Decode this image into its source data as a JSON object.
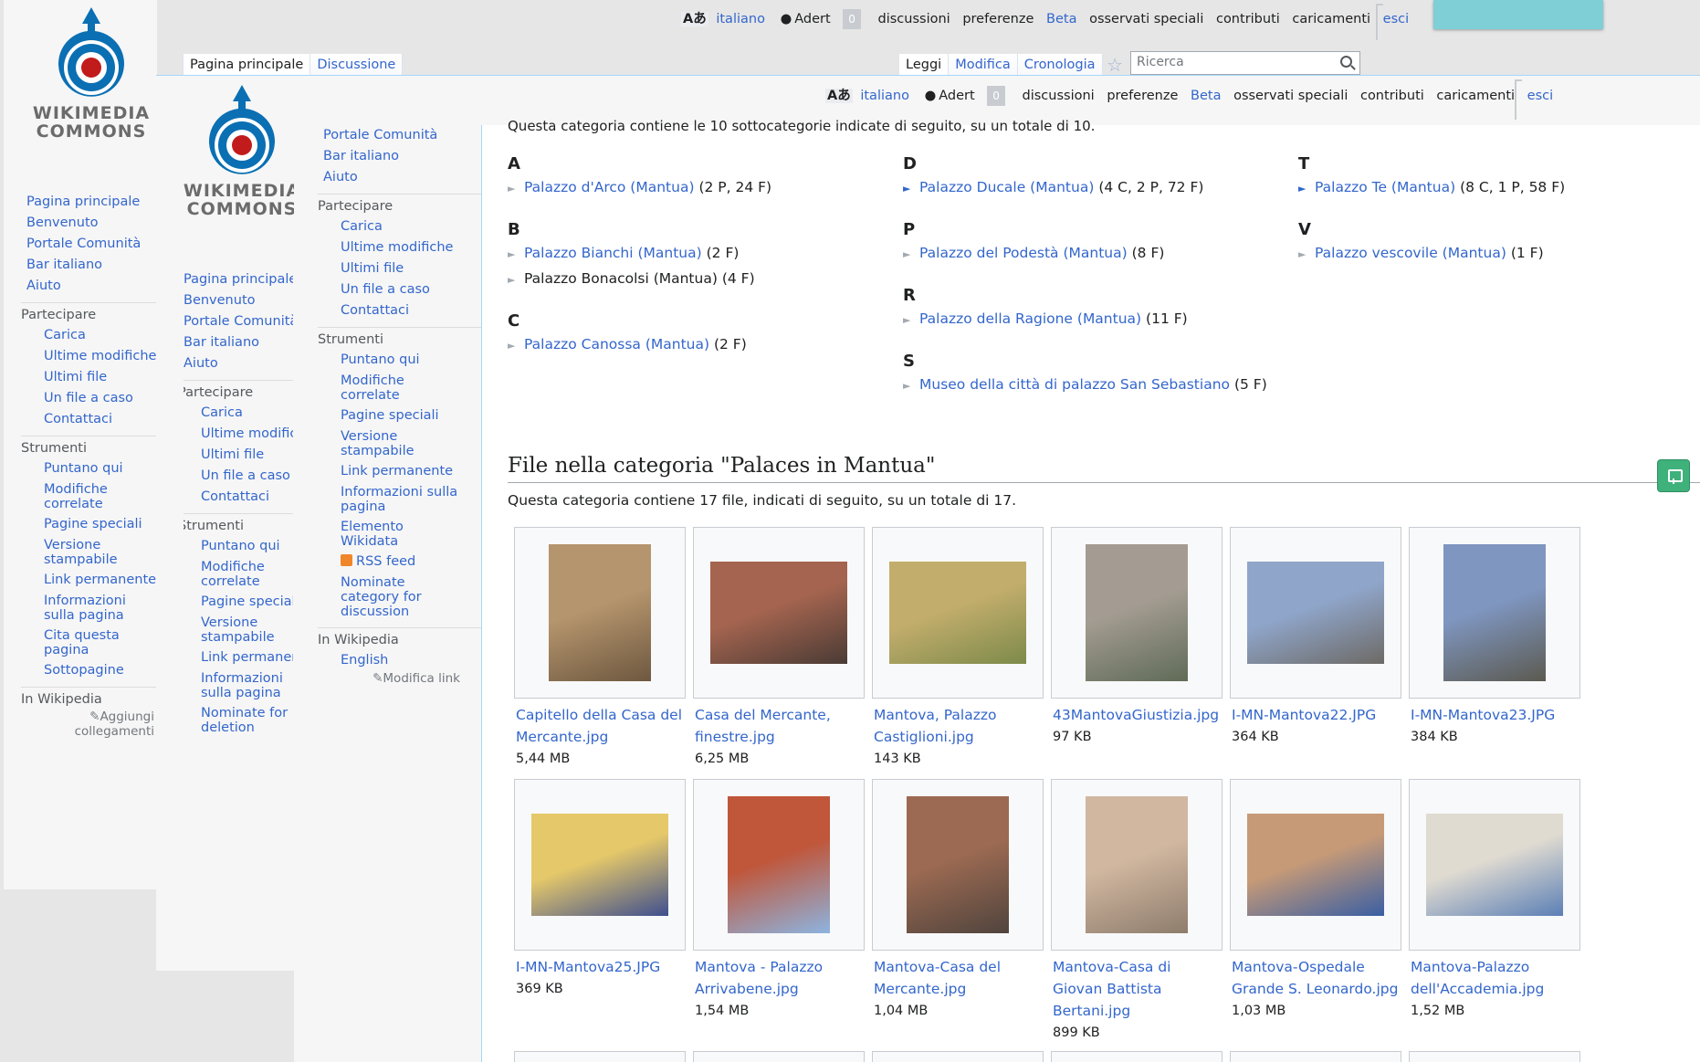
{
  "colors": {
    "link": "#3366cc",
    "badge": "#c8ccd1",
    "green_button": "#3fb17b",
    "teal_panel": "#7fcfd6"
  },
  "logo": {
    "line1": "WIKIMEDIA",
    "line2": "COMMONS"
  },
  "personal": {
    "lang_icon": "translate-icon",
    "language": "italiano",
    "user_icon": "user-icon",
    "user": "Adert",
    "notifications": "0",
    "talk": "discussioni",
    "preferences": "preferenze",
    "beta": "Beta",
    "watchlist": "osservati speciali",
    "contributions": "contributi",
    "uploads": "caricamenti",
    "logout": "esci"
  },
  "tabs": {
    "main_page": "Pagina principale",
    "discussion": "Discussione",
    "read": "Leggi",
    "edit": "Modifica",
    "history": "Cronologia"
  },
  "search": {
    "placeholder": "Ricerca"
  },
  "sidebar1": {
    "nav": [
      "Pagina principale",
      "Benvenuto",
      "Portale Comunità",
      "Bar italiano",
      "Aiuto"
    ],
    "participate_heading": "Partecipare",
    "participate": [
      "Carica",
      "Ultime modifiche",
      "Ultimi file",
      "Un file a caso",
      "Contattaci"
    ],
    "tools_heading": "Strumenti",
    "tools": [
      "Puntano qui",
      "Modifiche correlate",
      "Pagine speciali",
      "Versione stampabile",
      "Link permanente",
      "Informazioni sulla pagina",
      "Cita questa pagina",
      "Sottopagine"
    ],
    "wikipedia_heading": "In Wikipedia",
    "add_links": "Aggiungi collegamenti"
  },
  "sidebar2": {
    "nav": [
      "Pagina principale",
      "Benvenuto",
      "Portale Comunità",
      "Bar italiano",
      "Aiuto"
    ],
    "participate_heading": "Partecipare",
    "participate": [
      "Carica",
      "Ultime modifiche",
      "Ultimi file",
      "Un file a caso",
      "Contattaci"
    ],
    "tools_heading": "Strumenti",
    "tools": [
      "Puntano qui",
      "Modifiche correlate",
      "Pagine speciali",
      "Versione stampabile",
      "Link permanente",
      "Informazioni sulla pagina",
      "Nominate for deletion"
    ]
  },
  "sidebar3": {
    "nav": [
      "Portale Comunità",
      "Bar italiano",
      "Aiuto"
    ],
    "participate_heading": "Partecipare",
    "participate": [
      "Carica",
      "Ultime modifiche",
      "Ultimi file",
      "Un file a caso",
      "Contattaci"
    ],
    "tools_heading": "Strumenti",
    "tools": [
      "Puntano qui",
      "Modifiche correlate",
      "Pagine speciali",
      "Versione stampabile",
      "Link permanente",
      "Informazioni sulla pagina",
      "Elemento Wikidata"
    ],
    "rss": "RSS feed",
    "nominate": "Nominate category for discussion",
    "wikipedia_heading": "In Wikipedia",
    "english": "English",
    "edit_links": "Modifica link"
  },
  "content": {
    "intro": "Questa categoria contiene le 10 sottocategorie indicate di seguito, su un totale di 10.",
    "subcats": [
      {
        "letter": "A",
        "items": [
          {
            "name": "Palazzo d'Arco (Mantua)",
            "count": "(2 P, 24 F)",
            "expand": false
          }
        ]
      },
      {
        "letter": "B",
        "items": [
          {
            "name": "Palazzo Bianchi (Mantua)",
            "count": "(2 F)",
            "expand": false
          },
          {
            "name": "Palazzo Bonacolsi (Mantua)",
            "count": "(4 F)",
            "expand": false
          }
        ]
      },
      {
        "letter": "C",
        "items": [
          {
            "name": "Palazzo Canossa (Mantua)",
            "count": "(2 F)",
            "expand": false
          }
        ]
      },
      {
        "letter": "D",
        "items": [
          {
            "name": "Palazzo Ducale (Mantua)",
            "count": "(4 C, 2 P, 72 F)",
            "expand": true
          }
        ]
      },
      {
        "letter": "P",
        "items": [
          {
            "name": "Palazzo del Podestà (Mantua)",
            "count": "(8 F)",
            "expand": false
          }
        ]
      },
      {
        "letter": "R",
        "items": [
          {
            "name": "Palazzo della Ragione (Mantua)",
            "count": "(11 F)",
            "expand": false
          }
        ]
      },
      {
        "letter": "S",
        "items": [
          {
            "name": "Museo della città di palazzo San Sebastiano",
            "count": "(5 F)",
            "expand": false
          }
        ]
      },
      {
        "letter": "T",
        "items": [
          {
            "name": "Palazzo Te (Mantua)",
            "count": "(8 C, 1 P, 58 F)",
            "expand": true
          }
        ]
      },
      {
        "letter": "V",
        "items": [
          {
            "name": "Palazzo vescovile (Mantua)",
            "count": "(1 F)",
            "expand": false
          }
        ]
      }
    ],
    "files_title": "File nella categoria \"Palaces in Mantua\"",
    "files_intro": "Questa categoria contiene 17 file, indicati di seguito, su un totale di 17.",
    "files": [
      {
        "name": "Capitello della Casa del Mercante.jpg",
        "size": "5,44 MB",
        "colors": [
          "#b5956d",
          "#6e5840"
        ],
        "shape": "portrait"
      },
      {
        "name": "Casa del Mercante, finestre.jpg",
        "size": "6,25 MB",
        "colors": [
          "#a4644f",
          "#4a3b35"
        ],
        "shape": "landscape"
      },
      {
        "name": "Mantova, Palazzo Castiglioni.jpg",
        "size": "143 KB",
        "colors": [
          "#c2ad6c",
          "#7d8a4a"
        ],
        "shape": "landscape"
      },
      {
        "name": "43MantovaGiustizia.jpg",
        "size": "97 KB",
        "colors": [
          "#a49c92",
          "#5f6b57"
        ],
        "shape": "portrait"
      },
      {
        "name": "I-MN-Mantova22.JPG",
        "size": "364 KB",
        "colors": [
          "#8fa5c9",
          "#6d6a66"
        ],
        "shape": "landscape"
      },
      {
        "name": "I-MN-Mantova23.JPG",
        "size": "384 KB",
        "colors": [
          "#7f96c0",
          "#5b5a50"
        ],
        "shape": "portrait"
      },
      {
        "name": "I-MN-Mantova25.JPG",
        "size": "369 KB",
        "colors": [
          "#e5c86a",
          "#3f4f8e"
        ],
        "shape": "landscape"
      },
      {
        "name": "Mantova - Palazzo Arrivabene.jpg",
        "size": "1,54 MB",
        "colors": [
          "#c0563a",
          "#8db4e0"
        ],
        "shape": "portrait"
      },
      {
        "name": "Mantova-Casa del Mercante.jpg",
        "size": "1,04 MB",
        "colors": [
          "#9c6a52",
          "#50443d"
        ],
        "shape": "portrait"
      },
      {
        "name": "Mantova-Casa di Giovan Battista Bertani.jpg",
        "size": "899 KB",
        "colors": [
          "#d1b7a0",
          "#8e7d6d"
        ],
        "shape": "portrait"
      },
      {
        "name": "Mantova-Ospedale Grande S. Leonardo.jpg",
        "size": "1,03 MB",
        "colors": [
          "#c69a77",
          "#3a5fa3"
        ],
        "shape": "landscape"
      },
      {
        "name": "Mantova-Palazzo dell'Accademia.jpg",
        "size": "1,52 MB",
        "colors": [
          "#e0dbd1",
          "#5b7fb5"
        ],
        "shape": "landscape"
      }
    ]
  }
}
